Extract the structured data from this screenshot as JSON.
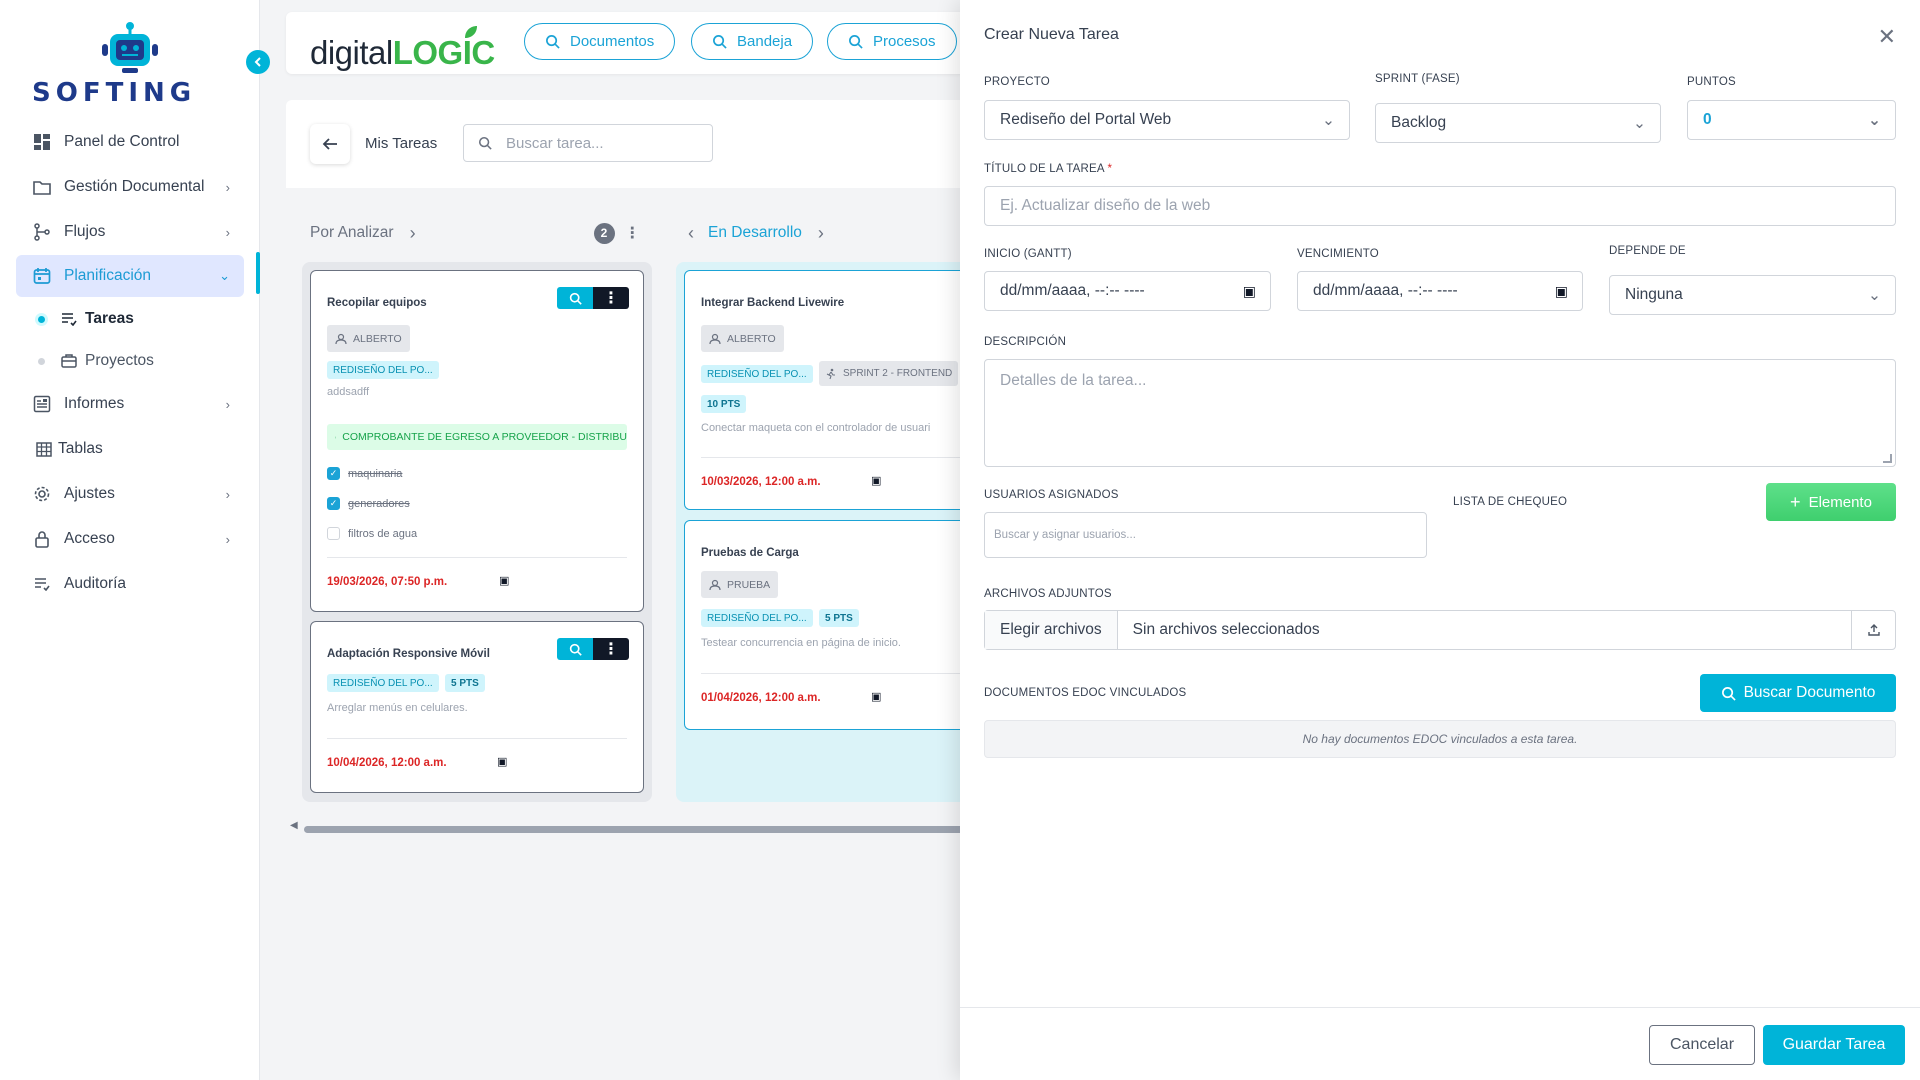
{
  "brand": {
    "name": "SOFTING",
    "colors": {
      "primary": "#1e3a8a",
      "accent": "#00b4d8",
      "green": "#39b54a",
      "danger": "#dc2626"
    }
  },
  "sidebar": {
    "items": [
      {
        "label": "Panel de Control",
        "icon": "dashboard-icon"
      },
      {
        "label": "Gestión Documental",
        "icon": "folder-icon"
      },
      {
        "label": "Flujos",
        "icon": "flow-icon"
      },
      {
        "label": "Planificación",
        "icon": "calendar-icon"
      },
      {
        "label": "Informes",
        "icon": "report-icon"
      },
      {
        "label": "Tablas",
        "icon": "table-icon"
      },
      {
        "label": "Ajustes",
        "icon": "gear-icon"
      },
      {
        "label": "Acceso",
        "icon": "lock-icon"
      },
      {
        "label": "Auditoría",
        "icon": "audit-icon"
      }
    ],
    "sub_items": [
      {
        "label": "Tareas",
        "icon": "tasks-icon"
      },
      {
        "label": "Proyectos",
        "icon": "briefcase-icon"
      }
    ]
  },
  "topbar": {
    "logo_prefix": "digital",
    "logo_suffix": "LOGIC",
    "buttons": [
      "Documentos",
      "Bandeja",
      "Procesos"
    ]
  },
  "board": {
    "title": "Mis Tareas",
    "search_placeholder": "Buscar tarea...",
    "columns": [
      {
        "name": "Por Analizar",
        "count": "2"
      },
      {
        "name": "En Desarrollo"
      }
    ],
    "cards": [
      {
        "title": "Recopilar equipos",
        "user": "ALBERTO",
        "project": "REDISEÑO DEL PO...",
        "desc": "addsadff",
        "doc": "COMPROBANTE DE EGRESO A PROVEEDOR - DISTRIBU",
        "checklist": [
          {
            "text": "maquinaria",
            "done": true
          },
          {
            "text": "generadores",
            "done": true
          },
          {
            "text": "filtros de agua",
            "done": false
          }
        ],
        "due": "19/03/2026, 07:50 p.m."
      },
      {
        "title": "Adaptación Responsive Móvil",
        "project": "REDISEÑO DEL PO...",
        "points": "5 PTS",
        "desc": "Arreglar menús en celulares.",
        "due": "10/04/2026, 12:00 a.m."
      },
      {
        "title": "Integrar Backend Livewire",
        "user": "ALBERTO",
        "project": "REDISEÑO DEL PO...",
        "sprint": "SPRINT 2 - FRONTEND",
        "points": "10 PTS",
        "desc": "Conectar maqueta con el controlador de usuari",
        "due": "10/03/2026, 12:00 a.m."
      },
      {
        "title": "Pruebas de Carga",
        "user": "PRUEBA",
        "project": "REDISEÑO DEL PO...",
        "points": "5 PTS",
        "desc": "Testear concurrencia en página de inicio.",
        "due": "01/04/2026, 12:00 a.m."
      }
    ]
  },
  "modal": {
    "title": "Crear Nueva Tarea",
    "labels": {
      "project": "PROYECTO",
      "sprint": "SPRINT (FASE)",
      "points": "PUNTOS",
      "task_title": "TÍTULO DE LA TAREA",
      "required_mark": "*",
      "start": "INICIO (GANTT)",
      "due": "VENCIMIENTO",
      "depends": "DEPENDE DE",
      "description": "DESCRIPCIÓN",
      "users": "USUARIOS ASIGNADOS",
      "checklist": "LISTA DE CHEQUEO",
      "attachments": "ARCHIVOS ADJUNTOS",
      "edoc": "DOCUMENTOS EDOC VINCULADOS"
    },
    "values": {
      "project": "Rediseño del Portal Web",
      "sprint": "Backlog",
      "points": "0",
      "depends": "Ninguna",
      "start": "dd/mm/aaaa, --:-- ----",
      "due": "dd/mm/aaaa, --:-- ----"
    },
    "placeholders": {
      "task_title": "Ej. Actualizar diseño de la web",
      "description": "Detalles de la tarea...",
      "users": "Buscar y asignar usuarios..."
    },
    "add_element_label": "Elemento",
    "file_choose_label": "Elegir archivos",
    "file_none_label": "Sin archivos seleccionados",
    "search_doc_label": "Buscar Documento",
    "edoc_empty": "No hay documentos EDOC vinculados a esta tarea.",
    "cancel_label": "Cancelar",
    "save_label": "Guardar Tarea"
  }
}
